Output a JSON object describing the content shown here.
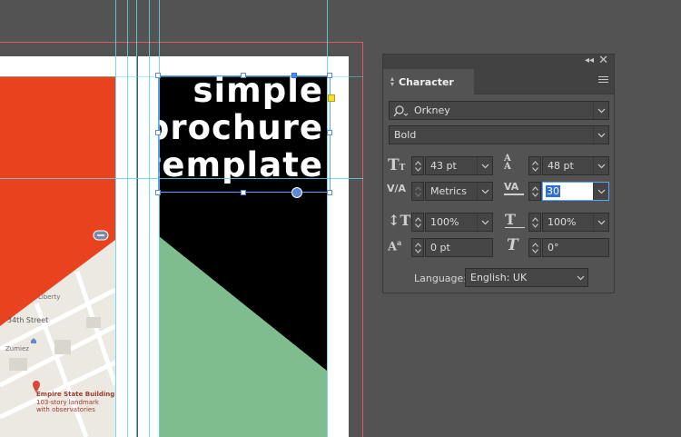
{
  "document": {
    "title_lines": [
      "simple",
      "brochure",
      "template"
    ],
    "colors": {
      "red": "#e8421f",
      "black": "#000000",
      "green": "#7fbd8e",
      "guide": "#5fd3e6",
      "bleed": "#e05a66"
    },
    "map": {
      "labels": [
        "Liberty",
        "34th Street",
        "Zumiez",
        "Empire State Building",
        "103-story landmark",
        "with observatories"
      ]
    }
  },
  "panel": {
    "tab_label": "Character",
    "font_family": "Orkney",
    "font_style": "Bold",
    "font_size": "43 pt",
    "leading": "48 pt",
    "kerning": "Metrics",
    "tracking": "30",
    "vertical_scale": "100%",
    "horizontal_scale": "100%",
    "baseline_shift": "0 pt",
    "skew": "0°",
    "language_label": "Language:",
    "language_value": "English: UK",
    "icons": {
      "collapse": "double-chevron-left-icon",
      "close": "close-icon",
      "menu": "hamburger-menu-icon",
      "search": "search-icon",
      "font_size": "font-size-icon",
      "leading": "leading-icon",
      "kerning": "kerning-icon",
      "tracking": "tracking-icon",
      "vertical_scale": "vertical-scale-icon",
      "horizontal_scale": "horizontal-scale-icon",
      "baseline_shift": "baseline-shift-icon",
      "skew": "skew-icon"
    }
  }
}
